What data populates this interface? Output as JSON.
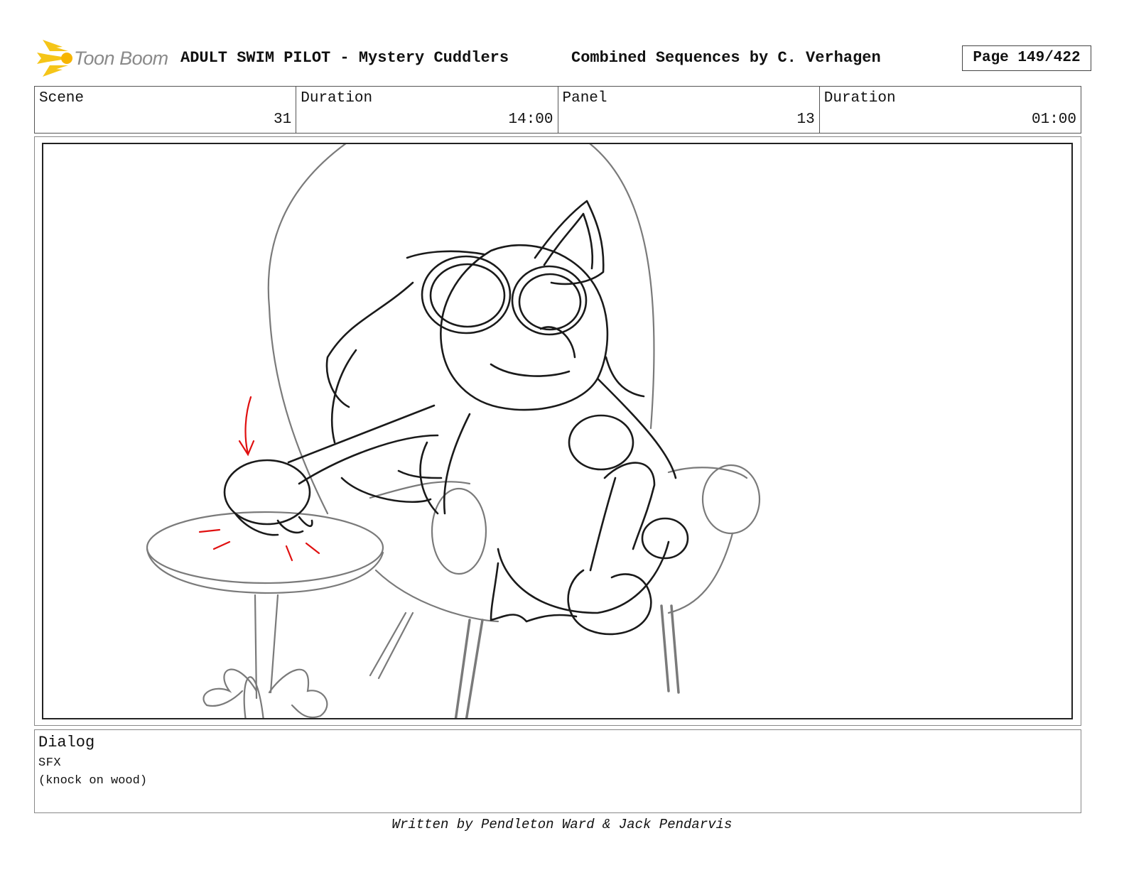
{
  "header": {
    "logo_text": "Toon Boom",
    "title": "ADULT SWIM PILOT - Mystery Cuddlers",
    "subtitle": "Combined Sequences by C. Verhagen",
    "page": "Page 149/422"
  },
  "info": {
    "scene_label": "Scene",
    "scene_value": "31",
    "scene_duration_label": "Duration",
    "scene_duration_value": "14:00",
    "panel_label": "Panel",
    "panel_value": "13",
    "panel_duration_label": "Duration",
    "panel_duration_value": "01:00"
  },
  "dialog": {
    "label": "Dialog",
    "line1": "SFX",
    "line2": "(knock on wood)"
  },
  "footer": {
    "credit": "Written by Pendleton Ward & Jack Pendarvis"
  },
  "colors": {
    "logo_accent": "#f5c518",
    "sketch_line": "#1a1a1a",
    "sketch_secondary": "#7a7a7a",
    "motion_mark": "#e01010"
  }
}
